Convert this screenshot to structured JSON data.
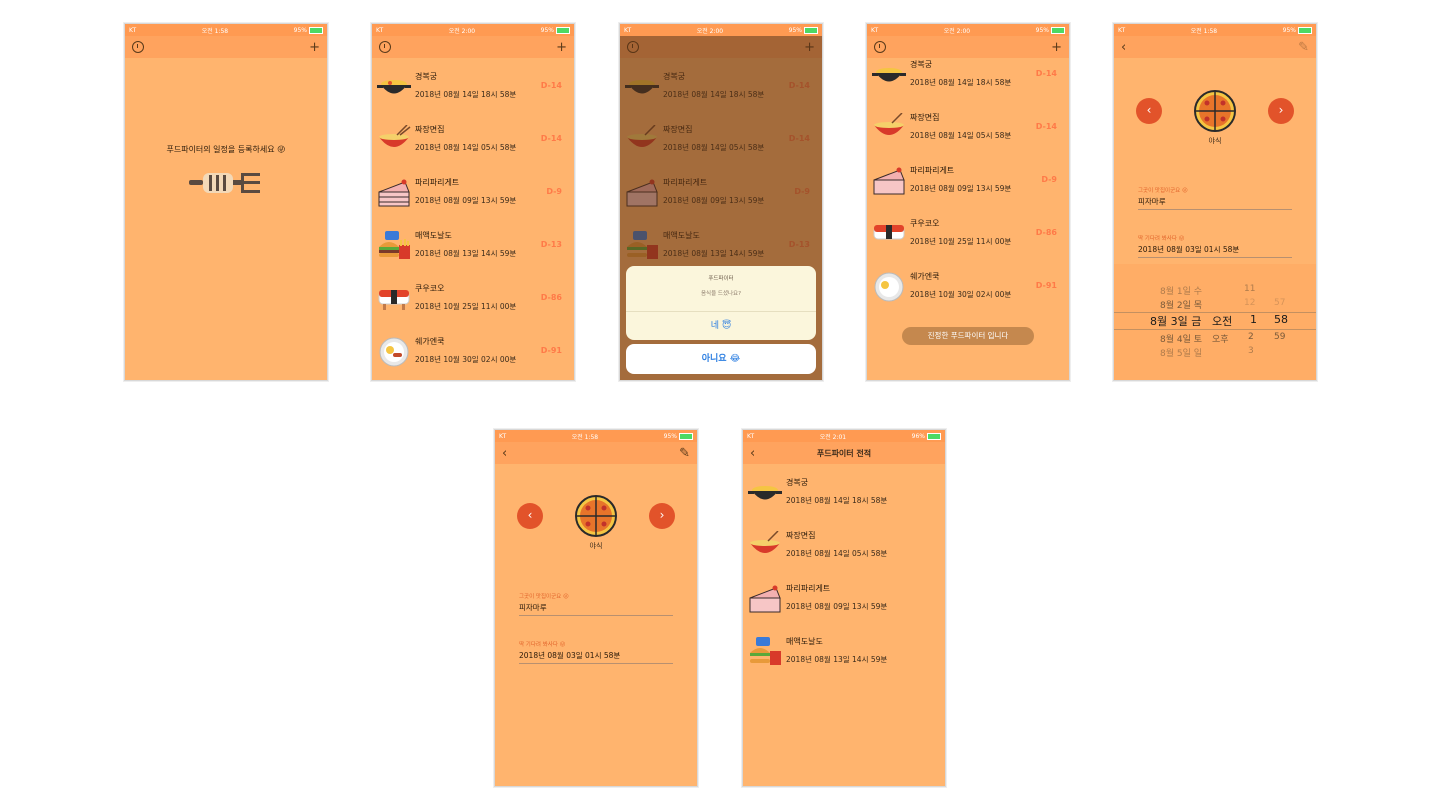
{
  "colors": {
    "accent": "#ffb46e",
    "nav": "#ffa35e",
    "status": "#ff9a52",
    "dday": "#ff7a48",
    "button": "#e2532a"
  },
  "status": {
    "carrier": "KT",
    "battery_95": "95%",
    "battery_96": "96%",
    "time_158": "오전 1:58",
    "time_200": "오전 2:00",
    "time_201": "오전 2:01"
  },
  "nav": {
    "add": "+",
    "back": "‹",
    "edit": "✎",
    "history_title": "푸드파이터 전적"
  },
  "empty": {
    "message": "푸드파이터의 일정을 등록하세요 😜"
  },
  "items": [
    {
      "name": "경복궁",
      "date": "2018년 08월 14일 18시 58분",
      "dday": "D-14",
      "icon": "pot-icon"
    },
    {
      "name": "짜장면집",
      "date": "2018년 08월 14일 05시 58분",
      "dday": "D-14",
      "icon": "noodle-bowl-icon"
    },
    {
      "name": "파리파리게트",
      "date": "2018년 08월 09일 13시 59분",
      "dday": "D-9",
      "icon": "cake-icon"
    },
    {
      "name": "매액도날도",
      "date": "2018년 08월 13일 14시 59분",
      "dday": "D-13",
      "icon": "burger-fries-icon"
    },
    {
      "name": "쿠우코오",
      "date": "2018년 10월 25일 11시 00분",
      "dday": "D-86",
      "icon": "sushi-icon"
    },
    {
      "name": "쉐가엔쿡",
      "date": "2018년 10월 30일 02시 00분",
      "dday": "D-91",
      "icon": "plate-icon"
    }
  ],
  "alert": {
    "title": "푸드파이터",
    "message": "음식을 드셨나요?",
    "yes": "네 😇",
    "no": "아니요 😂"
  },
  "phone4": {
    "pill": "진정한 푸드파이터 입니다"
  },
  "detail": {
    "category": "야식",
    "prev": "‹",
    "next": "›",
    "place_label": "그곳이 맛집이군요 😜",
    "place_value": "피자마루",
    "time_label": "딱 기다려 봐사다 😜",
    "time_value": "2018년 08월 03일 01시 58분"
  },
  "picker": {
    "rows": [
      {
        "date": "8월 1일 수",
        "ampm": "",
        "hour": "11",
        "min": ""
      },
      {
        "date": "8월 2일 목",
        "ampm": "",
        "hour": "12",
        "min": "57"
      },
      {
        "date": "8월 3일 금",
        "ampm": "오전",
        "hour": "1",
        "min": "58"
      },
      {
        "date": "8월 4일 토",
        "ampm": "오후",
        "hour": "2",
        "min": "59"
      },
      {
        "date": "8월 5일 일",
        "ampm": "",
        "hour": "3",
        "min": ""
      }
    ]
  }
}
